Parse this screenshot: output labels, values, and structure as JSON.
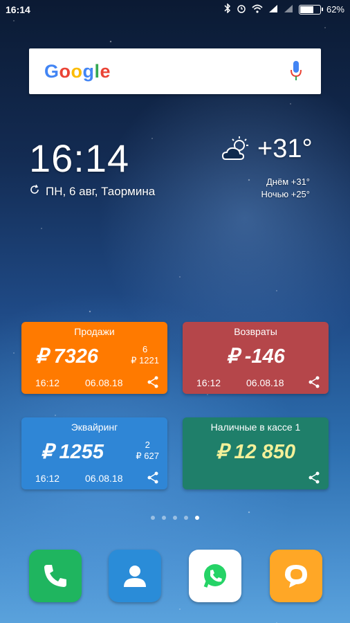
{
  "statusbar": {
    "time": "16:14",
    "battery": "62%",
    "battery_level": 0.62
  },
  "search": {
    "logo": "Google"
  },
  "clock": {
    "time": "16:14",
    "date_location": "ПН, 6 авг, Таормина"
  },
  "weather": {
    "temp": "+31°",
    "day": "Днём +31°",
    "night": "Ночью +25°"
  },
  "widgets": [
    {
      "title": "Продажи",
      "amount": "₽ 7326",
      "count": "6",
      "avg": "₽ 1221",
      "time": "16:12",
      "date": "06.08.18",
      "color": "#ff7a00"
    },
    {
      "title": "Возвраты",
      "amount": "₽ -146",
      "time": "16:12",
      "date": "06.08.18",
      "color": "#b5464a"
    },
    {
      "title": "Эквайринг",
      "amount": "₽ 1255",
      "count": "2",
      "avg": "₽ 627",
      "time": "16:12",
      "date": "06.08.18",
      "color": "#2f86d6"
    },
    {
      "title": "Наличные в кассе 1",
      "amount": "₽ 12 850",
      "color": "#1f7f6a",
      "amount_color": "#f3f099"
    }
  ],
  "dock": [
    {
      "name": "phone",
      "color": "#1fb55f"
    },
    {
      "name": "contacts",
      "color": "#2a8cd8"
    },
    {
      "name": "whatsapp",
      "color": "#ffffff"
    },
    {
      "name": "messages",
      "color": "#ffa726"
    }
  ]
}
